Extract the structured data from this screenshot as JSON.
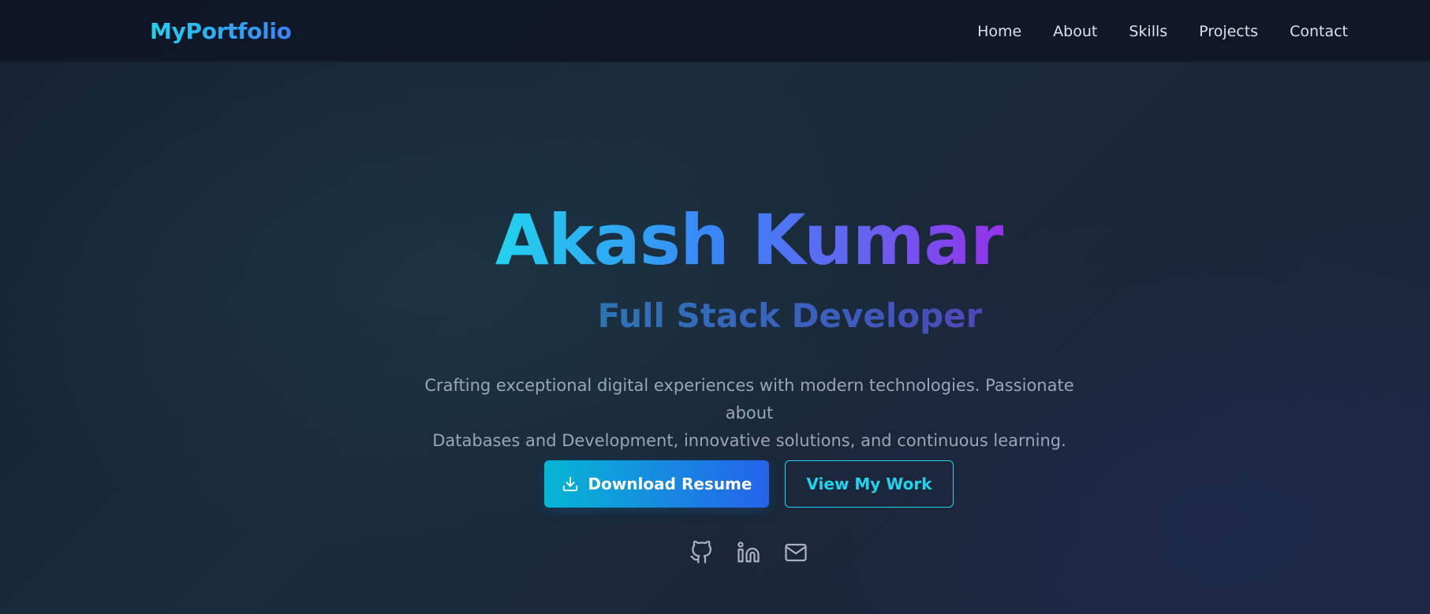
{
  "nav": {
    "brand": "MyPortfolio",
    "links": [
      "Home",
      "About",
      "Skills",
      "Projects",
      "Contact"
    ]
  },
  "hero": {
    "name": "Akash Kumar",
    "role": "Full Stack Developer",
    "description_line1": "Crafting exceptional digital experiences with modern technologies. Passionate about",
    "description_line2": "Databases and Development, innovative solutions, and continuous learning.",
    "primary_button": {
      "label": "Download Resume",
      "icon": "download-icon"
    },
    "secondary_button": {
      "label": "View My Work"
    }
  },
  "socials": [
    {
      "icon": "github-icon"
    },
    {
      "icon": "linkedin-icon"
    },
    {
      "icon": "mail-icon"
    }
  ],
  "colors": {
    "accent_cyan": "#22d3ee",
    "accent_blue": "#3b82f6",
    "accent_purple": "#9333ea",
    "background": "#0f172a"
  }
}
